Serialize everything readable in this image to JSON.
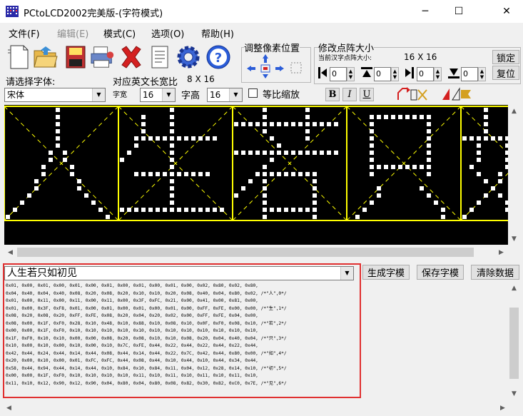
{
  "window": {
    "title": "PCtoLCD2002完美版-(字符模式)",
    "minimize": "─",
    "maximize": "☐",
    "close": "✕"
  },
  "menu": [
    {
      "label": "文件(F)",
      "enabled": true
    },
    {
      "label": "编辑(E)",
      "enabled": false
    },
    {
      "label": "模式(C)",
      "enabled": true
    },
    {
      "label": "选项(O)",
      "enabled": true
    },
    {
      "label": "帮助(H)",
      "enabled": true
    }
  ],
  "toolbar": {
    "icons": [
      "new-document-icon",
      "open-folder-icon",
      "save-disk-icon",
      "print-icon",
      "delete-x-icon",
      "notes-icon",
      "settings-gear-icon",
      "help-question-icon"
    ]
  },
  "pixel_adjust": {
    "title": "调整像素位置"
  },
  "dot_size": {
    "title": "修改点阵大小",
    "current_label": "当前汉字点阵大小:",
    "current_value": "16 X 16",
    "lock_button": "锁定",
    "reset_button": "复位",
    "spin_values": [
      "0",
      "0",
      "0",
      "0"
    ]
  },
  "font": {
    "choose_label": "请选择字体:",
    "font_name": "宋体",
    "ratio_label": "对应英文长宽比",
    "ratio_value": "8 X 16",
    "width_label": "字宽",
    "width_value": "16",
    "height_label": "字高",
    "height_value": "16",
    "keep_ratio_label": "等比缩放",
    "bold": "B",
    "italic": "I",
    "underline": "U"
  },
  "output": {
    "input_text": "人生若只如初见",
    "generate_button": "生成字模",
    "save_button": "保存字模",
    "clear_button": "清除数据",
    "code_lines": [
      "0x01, 0x00, 0x01, 0x00, 0x01, 0x00, 0x01, 0x00, 0x01, 0x00, 0x01, 0x00, 0x02, 0x80, 0x02, 0x80,",
      "0x04, 0x40, 0x04, 0x40, 0x08, 0x20, 0x08, 0x20, 0x10, 0x10, 0x20, 0x08, 0x40, 0x04, 0x80, 0x02, /*\"人\",0*/",
      "0x01, 0x00, 0x11, 0x00, 0x11, 0x00, 0x11, 0x00, 0x3F, 0xFC, 0x21, 0x00, 0x41, 0x00, 0x81, 0x00,",
      "0x01, 0x00, 0x3F, 0xF8, 0x01, 0x00, 0x01, 0x00, 0x01, 0x00, 0x01, 0x00, 0xFF, 0xFE, 0x00, 0x00, /*\"生\",1*/",
      "0x08, 0x20, 0x08, 0x20, 0xFF, 0xFE, 0x08, 0x20, 0x04, 0x20, 0x02, 0x00, 0xFF, 0xFE, 0x04, 0x00,",
      "0x08, 0x00, 0x1F, 0xF0, 0x28, 0x10, 0x48, 0x10, 0x88, 0x10, 0x08, 0x10, 0x0F, 0xF0, 0x08, 0x10, /*\"若\",2*/",
      "0x00, 0x00, 0x1F, 0xF0, 0x10, 0x10, 0x10, 0x10, 0x10, 0x10, 0x10, 0x10, 0x10, 0x10, 0x10, 0x10,",
      "0x1F, 0xF0, 0x10, 0x10, 0x00, 0x00, 0x08, 0x20, 0x08, 0x10, 0x10, 0x08, 0x20, 0x04, 0x40, 0x04, /*\"只\",3*/",
      "0x10, 0x00, 0x10, 0x00, 0x10, 0x00, 0x10, 0x7C, 0xFE, 0x44, 0x22, 0x44, 0x22, 0x44, 0x22, 0x44,",
      "0x42, 0x44, 0x24, 0x44, 0x14, 0x44, 0x08, 0x44, 0x14, 0x44, 0x22, 0x7C, 0x42, 0x44, 0x80, 0x00, /*\"如\",4*/",
      "0x20, 0x00, 0x10, 0x00, 0x01, 0xFC, 0xFC, 0x44, 0x08, 0x44, 0x10, 0x44, 0x10, 0x44, 0x34, 0x44,",
      "0x58, 0x44, 0x94, 0x44, 0x14, 0x44, 0x10, 0x84, 0x10, 0x84, 0x11, 0x04, 0x12, 0x28, 0x14, 0x10, /*\"初\",5*/",
      "0x00, 0x00, 0x1F, 0xF0, 0x10, 0x10, 0x10, 0x10, 0x11, 0x10, 0x11, 0x10, 0x11, 0x10, 0x11, 0x10,",
      "0x11, 0x10, 0x12, 0x90, 0x12, 0x90, 0x04, 0x80, 0x04, 0x80, 0x08, 0x82, 0x30, 0x82, 0xC0, 0x7E, /*\"见\",6*/"
    ]
  },
  "preview": {
    "glyph_color": "#ffffff",
    "grid_color": "#ffff00",
    "background": "#000000",
    "chars": [
      "人",
      "生",
      "若",
      "只",
      "如"
    ]
  },
  "colors": {
    "highlight_border": "#e03030"
  }
}
